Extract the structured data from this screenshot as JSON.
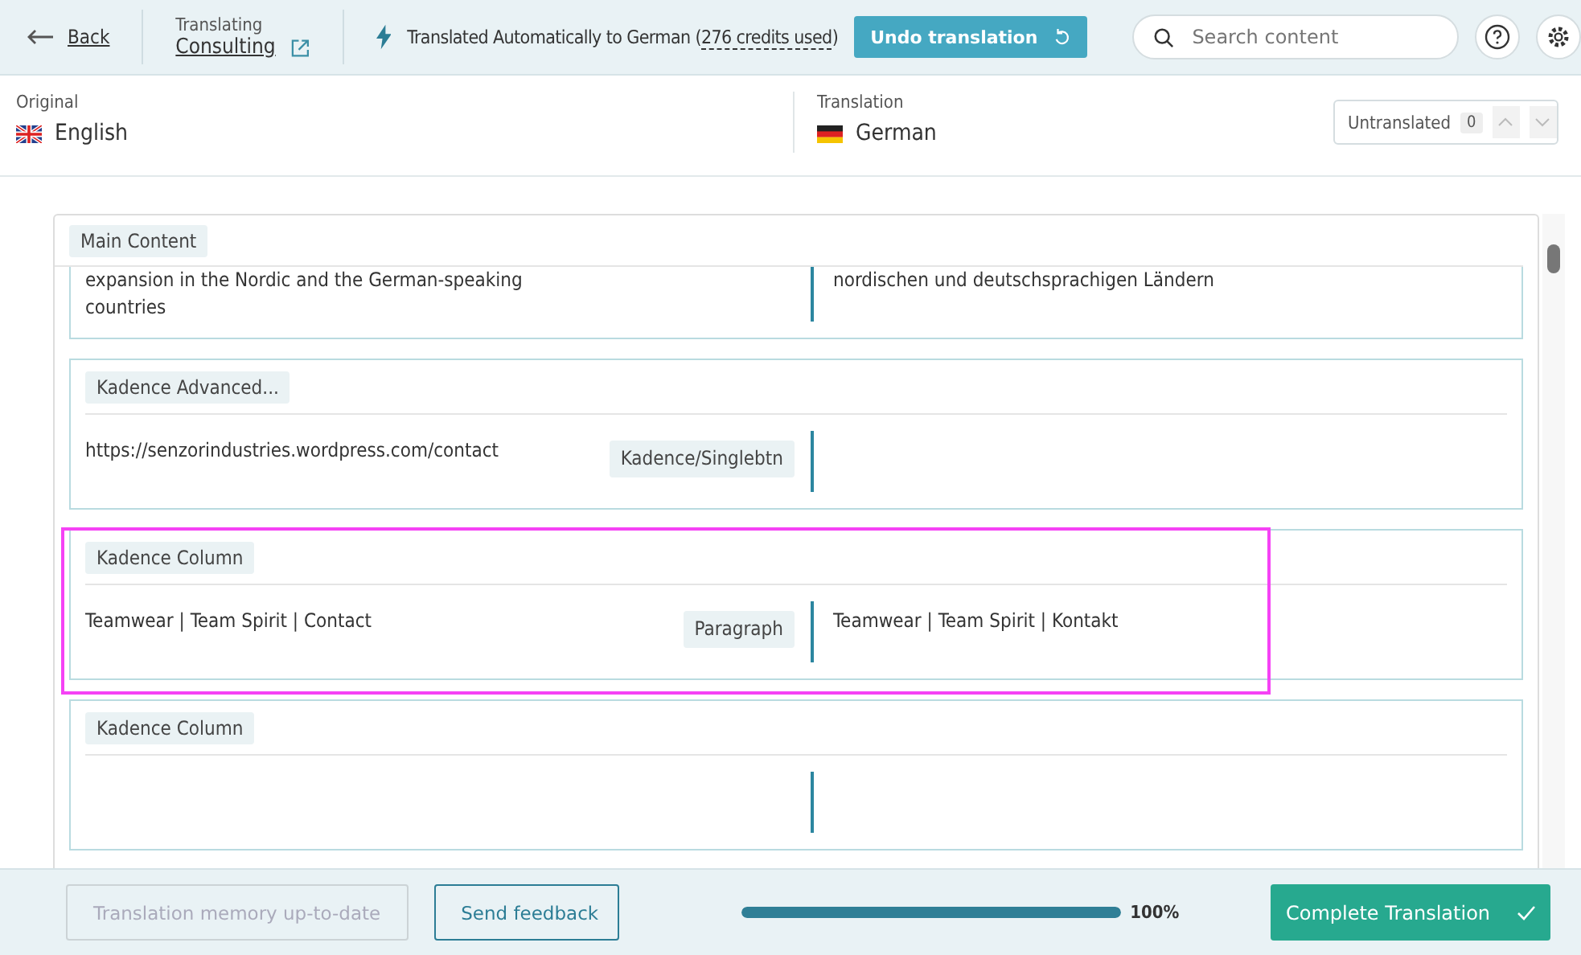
{
  "topbar": {
    "back": "Back",
    "translating_label": "Translating",
    "page_title": "Consulting",
    "auto_notice": "Translated Automatically to German (",
    "credits": "276 credits used",
    "auto_notice_end": ")",
    "undo_button": "Undo translation",
    "search": {
      "placeholder": "Search content"
    }
  },
  "languages": {
    "original_label": "Original",
    "original": "English",
    "translation_label": "Translation",
    "translation": "German",
    "untranslated": {
      "label": "Untranslated",
      "count": "0"
    }
  },
  "section_label": "Main Content",
  "segments": [
    {
      "source": "expansion in the Nordic and the German-speaking countries",
      "target": "nordischen und deutschsprachigen Ländern",
      "highlighted": false
    },
    {
      "group": "Kadence Advanced...",
      "source": "https://senzorindustries.wordpress.com/contact",
      "tag": "Kadence/Singlebtn",
      "highlighted": false
    },
    {
      "group": "Kadence Column",
      "source": "Teamwear | Team Spirit | Contact",
      "tag": "Paragraph",
      "target": "Teamwear | Team Spirit | Kontakt",
      "highlighted": true
    },
    {
      "group": "Kadence Column",
      "highlighted": false
    }
  ],
  "footer": {
    "memory_button": {
      "label": "Translation memory up-to-date",
      "disabled": true
    },
    "feedback_button": "Send feedback",
    "progress": {
      "level": 1.0,
      "reading": "100%"
    },
    "complete_button": "Complete Translation"
  }
}
